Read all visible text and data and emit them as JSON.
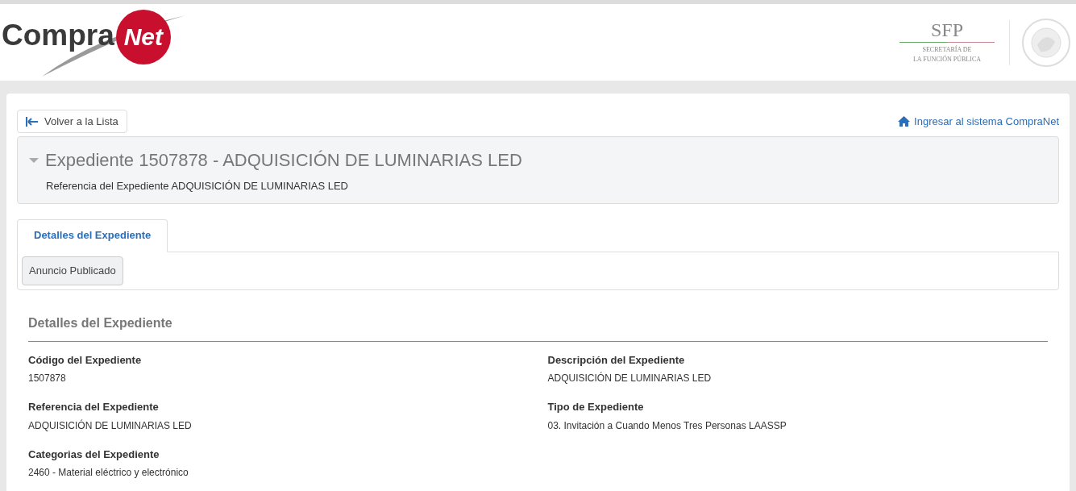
{
  "header": {
    "logo": {
      "word": "Compra",
      "accent": "Net"
    },
    "agency": {
      "abbr": "SFP",
      "line_1": "SECRETARÍA DE",
      "line_2": "LA FUNCIÓN PÚBLICA"
    }
  },
  "back_button": "Volver a la Lista",
  "login_link": "Ingresar al sistema CompraNet",
  "expediente": {
    "title": "Expediente 1507878 - ADQUISICIÓN DE LUMINARIAS LED",
    "subtitle": "Referencia del Expediente ADQUISICIÓN DE LUMINARIAS LED",
    "expanded": true
  },
  "tabs": [
    {
      "label": "Detalles del Expediente",
      "selected": true
    }
  ],
  "subtabs": [
    {
      "label": "Anuncio Publicado",
      "selected": true
    }
  ],
  "section": {
    "title": "Detalles del Expediente",
    "fields": [
      {
        "label": "Código del Expediente",
        "value": "1507878"
      },
      {
        "label": "Descripción del Expediente",
        "value": "ADQUISICIÓN DE LUMINARIAS LED"
      },
      {
        "label": "Referencia del Expediente",
        "value": "ADQUISICIÓN DE LUMINARIAS LED"
      },
      {
        "label": "Tipo de Expediente",
        "value": "03. Invitación a Cuando Menos Tres Personas LAASSP"
      },
      {
        "label": "Categorias del Expediente",
        "value": "2460 - Material eléctrico y electrónico"
      }
    ]
  }
}
